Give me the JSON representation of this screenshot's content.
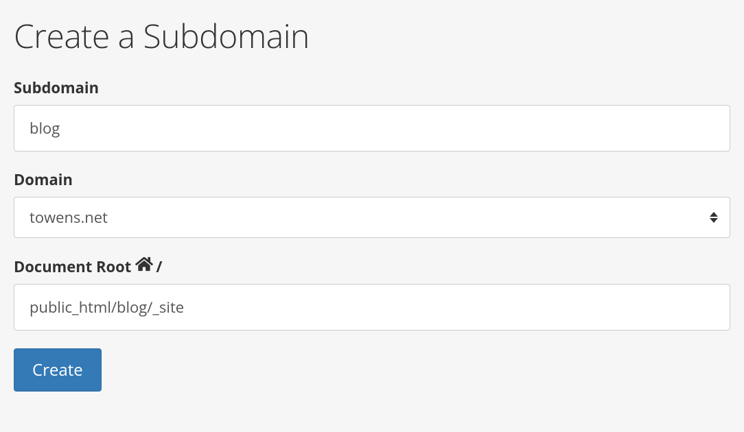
{
  "heading": "Create a Subdomain",
  "form": {
    "subdomain": {
      "label": "Subdomain",
      "value": "blog"
    },
    "domain": {
      "label": "Domain",
      "selected": "towens.net"
    },
    "document_root": {
      "label": "Document Root",
      "suffix": "/",
      "value": "public_html/blog/_site"
    },
    "submit_label": "Create"
  }
}
